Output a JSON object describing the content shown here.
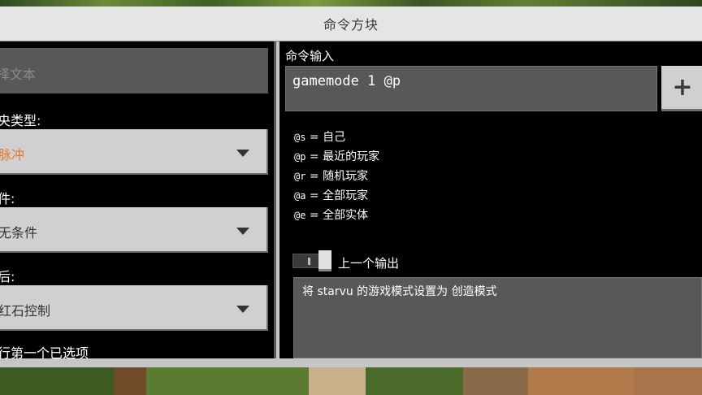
{
  "window": {
    "title": "命令方块"
  },
  "left": {
    "hover_note_placeholder": "择文本",
    "block_type": {
      "label": "央类型:",
      "value": "脉冲",
      "value_color": "#e8782c"
    },
    "condition": {
      "label": "件:",
      "value": "无条件"
    },
    "redstone": {
      "label": "后:",
      "value": "红石控制"
    },
    "execute_first_label": "行第一个已选项"
  },
  "right": {
    "command_input_label": "命令输入",
    "command_input_value": "gamemode 1 @p",
    "plus_icon": "plus-icon",
    "selectors": [
      {
        "code": "@s",
        "desc": " = 自己"
      },
      {
        "code": "@p",
        "desc": " = 最近的玩家"
      },
      {
        "code": "@r",
        "desc": " = 随机玩家"
      },
      {
        "code": "@a",
        "desc": " = 全部玩家"
      },
      {
        "code": "@e",
        "desc": " = 全部实体"
      }
    ],
    "previous_output_label": "上一个输出",
    "previous_output_text": "将 starvu 的游戏模式设置为 创造模式"
  },
  "colors": {
    "panel_bg": "#000000",
    "dialog_bg": "#c6c6c6",
    "accent_orange": "#e8782c"
  }
}
